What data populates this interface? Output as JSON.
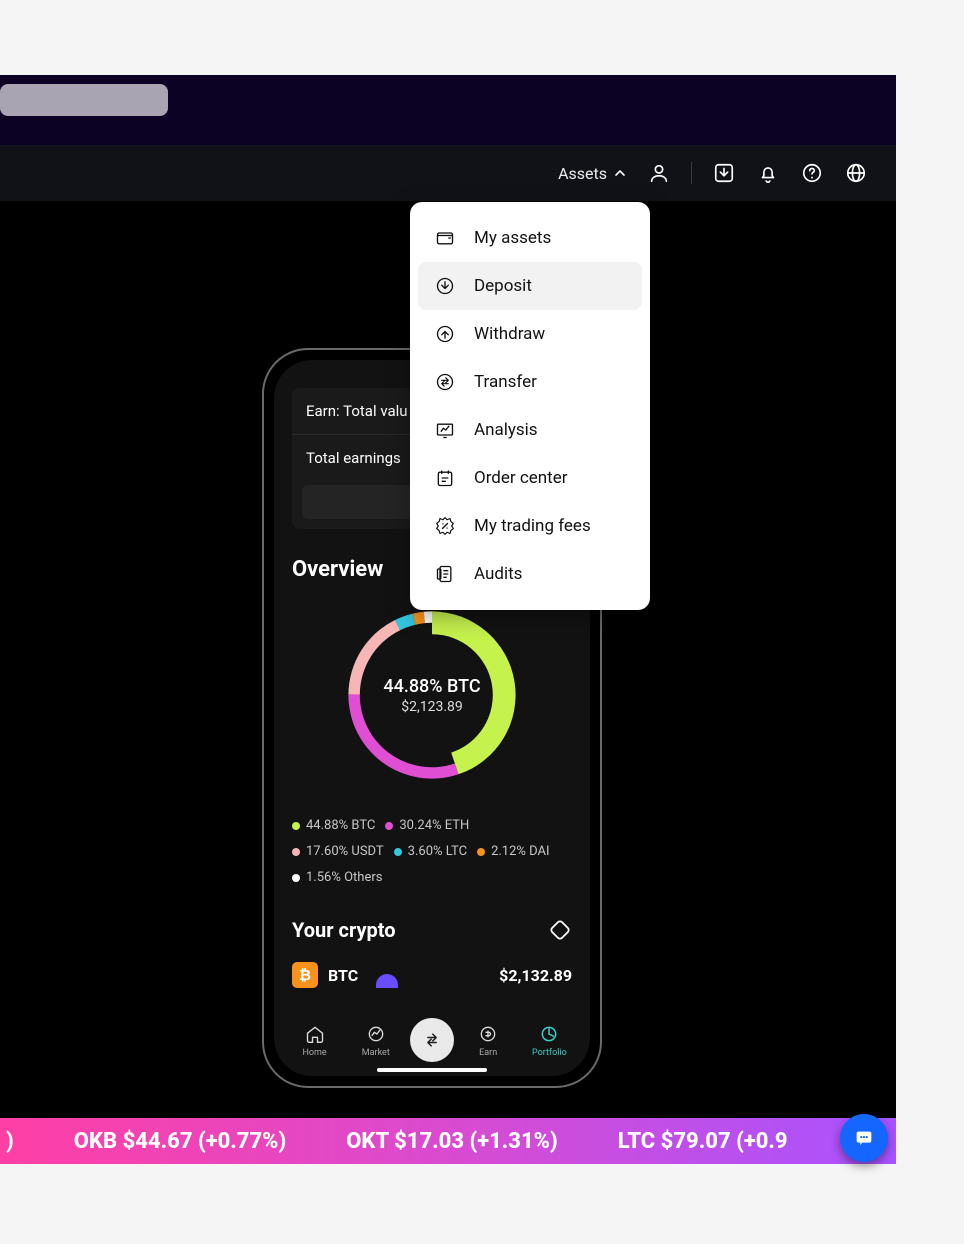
{
  "topbar": {
    "assets_label": "Assets"
  },
  "dropdown": {
    "items": [
      {
        "label": "My assets",
        "icon": "wallet-icon",
        "active": false
      },
      {
        "label": "Deposit",
        "icon": "deposit-icon",
        "active": true
      },
      {
        "label": "Withdraw",
        "icon": "withdraw-icon",
        "active": false
      },
      {
        "label": "Transfer",
        "icon": "transfer-icon",
        "active": false
      },
      {
        "label": "Analysis",
        "icon": "analysis-icon",
        "active": false
      },
      {
        "label": "Order center",
        "icon": "order-center-icon",
        "active": false
      },
      {
        "label": "My trading fees",
        "icon": "fees-icon",
        "active": false
      },
      {
        "label": "Audits",
        "icon": "audits-icon",
        "active": false
      }
    ]
  },
  "phone": {
    "card": {
      "row1": "Earn: Total valu",
      "row2": "Total earnings"
    },
    "overview_title": "Overview",
    "donut_center_pct": "44.88% BTC",
    "donut_center_amount": "$2,123.89",
    "your_crypto_title": "Your crypto",
    "crypto_row": {
      "symbol": "BTC",
      "amount": "$2,132.89"
    },
    "nav": {
      "home": "Home",
      "market": "Market",
      "earn": "Earn",
      "portfolio": "Portfolio"
    }
  },
  "chart_data": {
    "type": "pie",
    "title": "Overview",
    "series": [
      {
        "name": "BTC",
        "value": 44.88,
        "color": "#c6f24d"
      },
      {
        "name": "ETH",
        "value": 30.24,
        "color": "#e04fd3"
      },
      {
        "name": "USDT",
        "value": 17.6,
        "color": "#f7b6b6"
      },
      {
        "name": "LTC",
        "value": 3.6,
        "color": "#35c6e0"
      },
      {
        "name": "DAI",
        "value": 2.12,
        "color": "#f7931a"
      },
      {
        "name": "Others",
        "value": 1.56,
        "color": "#ffffff"
      }
    ]
  },
  "ticker": {
    "items": [
      {
        "symbol": "OKB",
        "price": "$44.67",
        "change": "(+0.77%)"
      },
      {
        "symbol": "OKT",
        "price": "$17.03",
        "change": "(+1.31%)"
      },
      {
        "symbol": "LTC",
        "price": "$79.07",
        "change": "(+0.9"
      }
    ],
    "leading_fragment": ")"
  }
}
